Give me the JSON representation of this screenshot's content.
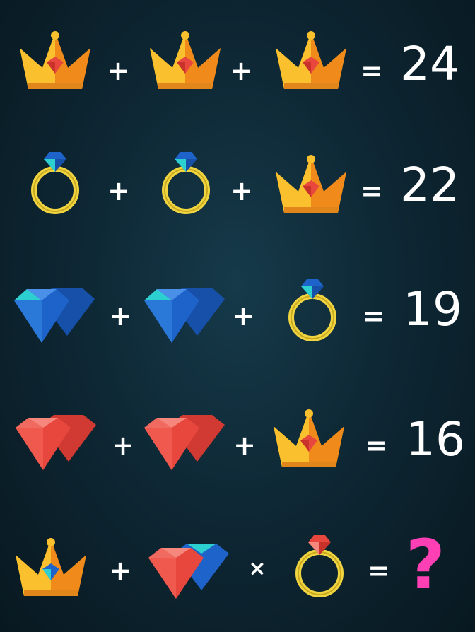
{
  "puzzle": {
    "colors": {
      "background": "#0e2835",
      "crown_gold": "#f6b01f",
      "ring_gold": "#f0d540",
      "blue_gem": "#1e63c9",
      "red_gem": "#e8473e",
      "question_mark": "#ff3fb4",
      "text": "#ffffff"
    },
    "rows": [
      {
        "icons": [
          "crown-red-gem-icon",
          "crown-red-gem-icon",
          "crown-red-gem-icon"
        ],
        "op1": "+",
        "op2": "+",
        "eq": "=",
        "result": "24"
      },
      {
        "icons": [
          "ring-blue-gem-icon",
          "ring-blue-gem-icon",
          "crown-red-gem-icon"
        ],
        "op1": "+",
        "op2": "+",
        "eq": "=",
        "result": "22"
      },
      {
        "icons": [
          "blue-diamonds-icon",
          "blue-diamonds-icon",
          "ring-blue-gem-icon"
        ],
        "op1": "+",
        "op2": "+",
        "eq": "=",
        "result": "19"
      },
      {
        "icons": [
          "red-diamonds-icon",
          "red-diamonds-icon",
          "crown-red-gem-icon"
        ],
        "op1": "+",
        "op2": "+",
        "eq": "=",
        "result": "16"
      },
      {
        "icons": [
          "crown-blue-gem-icon",
          "red-blue-diamond-icon",
          "ring-red-gem-icon"
        ],
        "op1": "+",
        "op2": "×",
        "eq": "=",
        "result": "?"
      }
    ]
  }
}
